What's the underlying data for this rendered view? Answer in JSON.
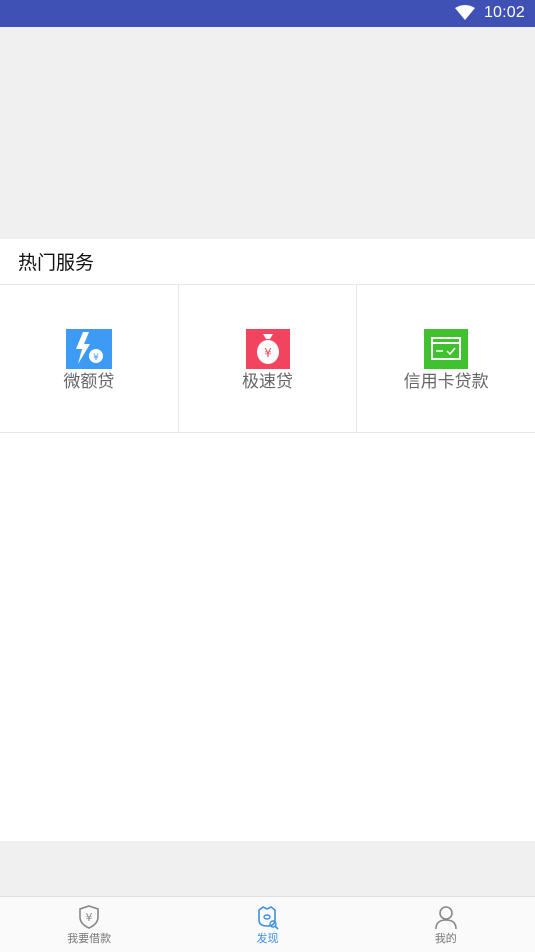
{
  "status_bar": {
    "time": "10:02",
    "wifi_icon": "wifi-icon",
    "background": "#3f51b5"
  },
  "section": {
    "title": "热门服务"
  },
  "services": [
    {
      "label": "微额贷",
      "icon": "lightning-yen-icon",
      "color": "#3d9bf5"
    },
    {
      "label": "极速贷",
      "icon": "money-bag-icon",
      "color": "#f2445e"
    },
    {
      "label": "信用卡贷款",
      "icon": "credit-card-icon",
      "color": "#3fc130"
    }
  ],
  "bottom_nav": {
    "items": [
      {
        "label": "我要借款",
        "icon": "shield-yen-icon",
        "active": false
      },
      {
        "label": "发现",
        "icon": "discover-icon",
        "active": true
      },
      {
        "label": "我的",
        "icon": "user-icon",
        "active": false
      }
    ],
    "active_color": "#3d8fe0"
  }
}
